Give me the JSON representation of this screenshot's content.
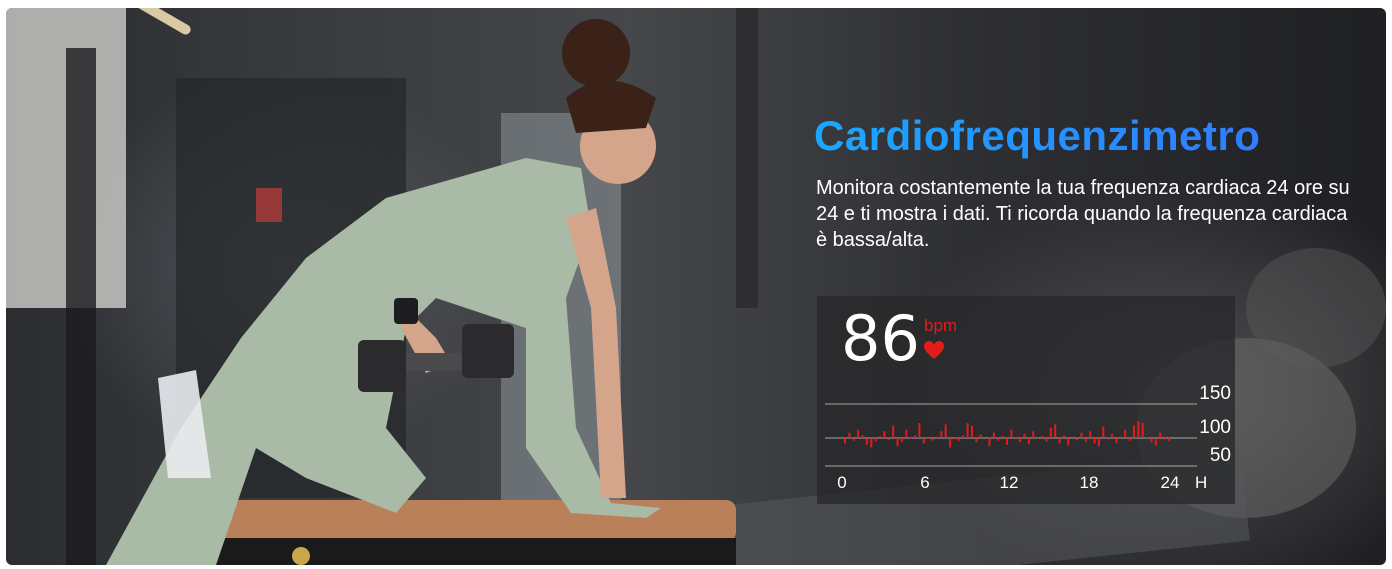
{
  "banner": {
    "title": "Cardiofrequenzimetro",
    "description": "Monitora costantemente la tua frequenza cardiaca 24 ore su 24 e ti mostra i dati. Ti ricorda quando la frequenza cardiaca è bassa/alta.",
    "accent_color": "#1e9bff"
  },
  "heart_rate": {
    "value": "86",
    "unit": "bpm",
    "unit_color": "#e21b1b",
    "icon": "heart-icon"
  },
  "chart_data": {
    "type": "bar",
    "x_ticks": [
      "0",
      "6",
      "12",
      "18",
      "24"
    ],
    "x_unit": "H",
    "y_ticks": [
      "150",
      "100",
      "50"
    ],
    "xlim": [
      0,
      24
    ],
    "baseline": 100,
    "series_color": "#e21b1b",
    "values": [
      92,
      108,
      96,
      112,
      104,
      90,
      86,
      95,
      103,
      110,
      97,
      118,
      88,
      94,
      112,
      99,
      104,
      122,
      92,
      99,
      96,
      102,
      110,
      120,
      86,
      98,
      96,
      104,
      122,
      118,
      94,
      105,
      100,
      88,
      108,
      96,
      103,
      90,
      112,
      98,
      94,
      106,
      91,
      110,
      99,
      103,
      95,
      115,
      120,
      92,
      104,
      89,
      100,
      97,
      108,
      94,
      110,
      92,
      88,
      117,
      98,
      106,
      92,
      102,
      112,
      96,
      118,
      124,
      122,
      101,
      94,
      89,
      108,
      98,
      96
    ]
  }
}
